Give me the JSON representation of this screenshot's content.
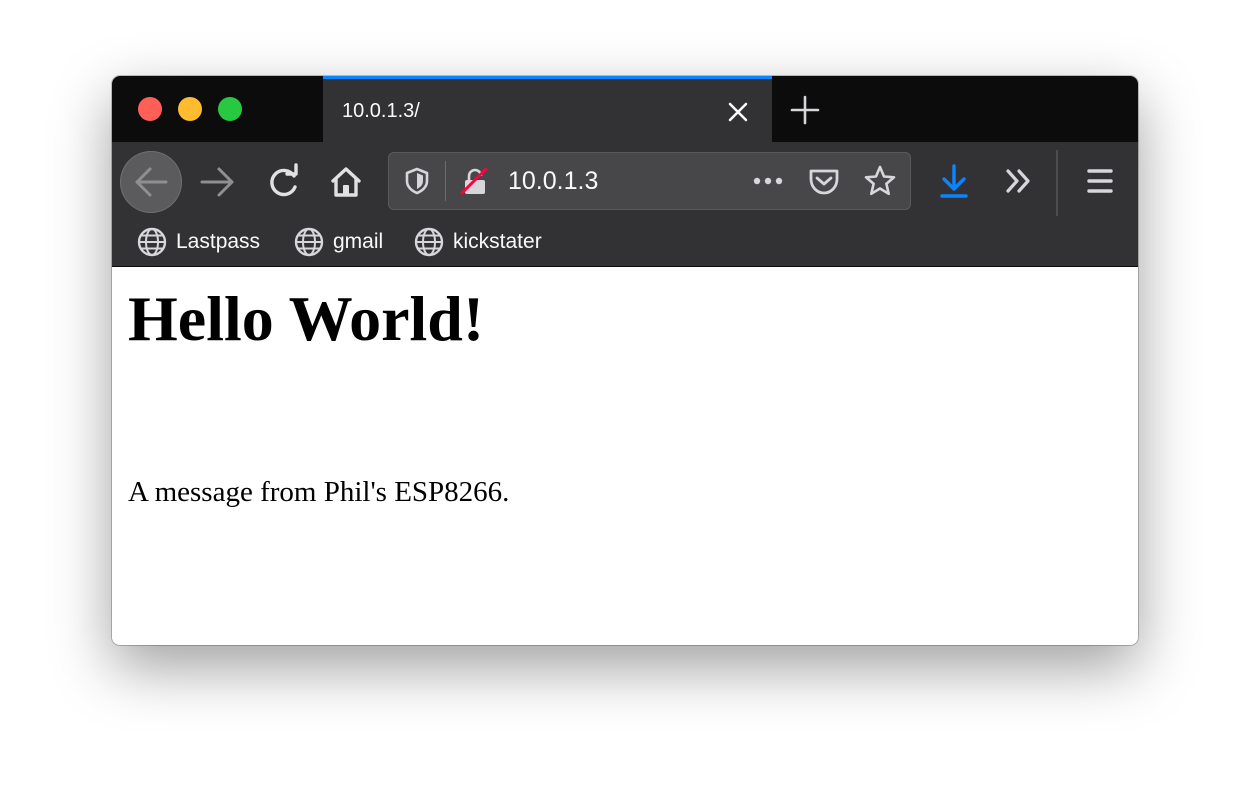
{
  "window": {
    "controls": [
      "close",
      "minimize",
      "zoom"
    ]
  },
  "tab": {
    "title": "10.0.1.3/",
    "close_icon": "close-icon",
    "new_tab_icon": "plus-icon"
  },
  "toolbar": {
    "back_icon": "arrow-left-icon",
    "forward_icon": "arrow-right-icon",
    "reload_icon": "reload-icon",
    "home_icon": "home-icon",
    "url": "10.0.1.3",
    "tracking_protection_icon": "shield-icon",
    "insecure_icon": "lock-strikethrough-icon",
    "page_actions_icon": "more-horizontal-icon",
    "pocket_icon": "pocket-icon",
    "bookmark_icon": "star-icon",
    "downloads_icon": "download-arrow-icon",
    "overflow_icon": "double-chevron-right-icon",
    "menu_icon": "hamburger-menu-icon",
    "accent_color": "#0a84ff"
  },
  "bookmarks": [
    {
      "label": "Lastpass",
      "icon": "globe-icon"
    },
    {
      "label": "gmail",
      "icon": "globe-icon"
    },
    {
      "label": "kickstater",
      "icon": "globe-icon"
    }
  ],
  "page": {
    "heading": "Hello World!",
    "message": "A message from Phil's ESP8266."
  }
}
